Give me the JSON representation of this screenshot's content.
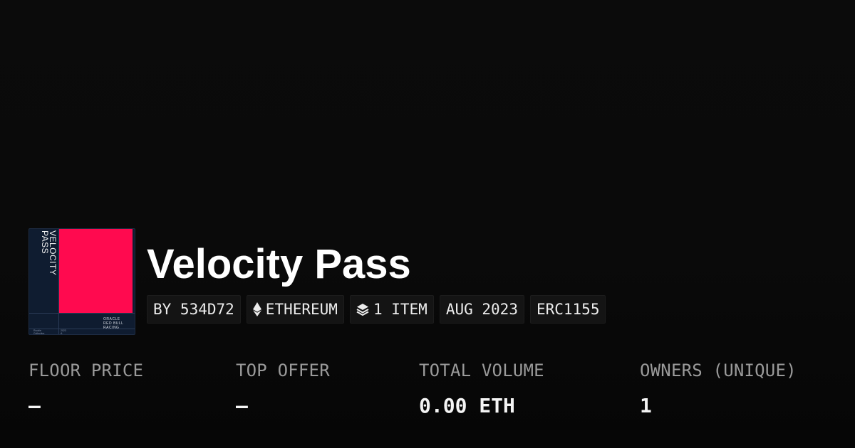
{
  "collection": {
    "title": "Velocity Pass",
    "thumbnail": {
      "vertical_text": "VELOCITY\nPASS",
      "brand_text": "ORACLE\nRED BULL\nRACING",
      "meta_left": "Rookie",
      "meta_left_value": "2023",
      "meta_left2": "Collection",
      "meta_left2_value": "A",
      "accent_color": "#ff0a4f",
      "bg_color": "#0f1c30"
    }
  },
  "tags": [
    {
      "label": "BY 534D72",
      "icon": null
    },
    {
      "label": "ETHEREUM",
      "icon": "ethereum-icon"
    },
    {
      "label": "1 ITEM",
      "icon": "layers-icon"
    },
    {
      "label": "AUG 2023",
      "icon": null
    },
    {
      "label": "ERC1155",
      "icon": null
    }
  ],
  "stats": [
    {
      "label": "FLOOR PRICE",
      "value": "–"
    },
    {
      "label": "TOP OFFER",
      "value": "–"
    },
    {
      "label": "TOTAL VOLUME",
      "value": "0.00 ETH"
    },
    {
      "label": "OWNERS (UNIQUE)",
      "value": "1"
    }
  ]
}
